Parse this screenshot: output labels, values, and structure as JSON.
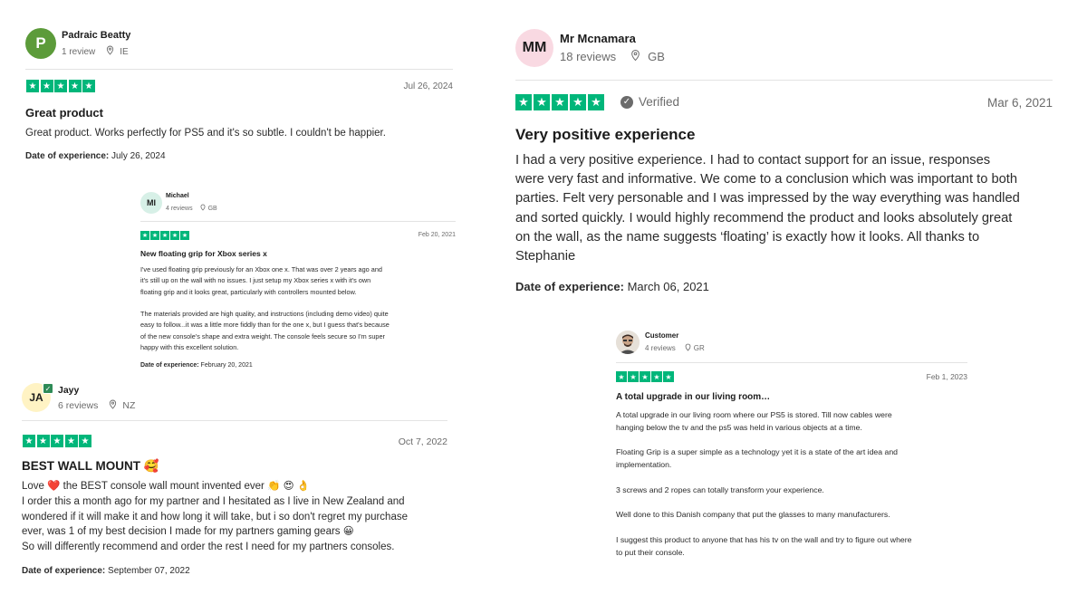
{
  "colors": {
    "star_green": "#00b67a",
    "avatar_p": "#5c9b3a",
    "avatar_mi": "#d7f0e7",
    "avatar_ja": "#fff3c4",
    "avatar_mm": "#f9d9e2"
  },
  "reviews": [
    {
      "avatar_text": "P",
      "name": "Padraic Beatty",
      "review_count": "1 review",
      "country": "IE",
      "date": "Jul 26, 2024",
      "title": "Great product",
      "body": "Great product. Works perfectly for PS5 and it's so subtle. I couldn't be happier.",
      "doe_label": "Date of experience:",
      "doe_value": "July 26, 2024"
    },
    {
      "avatar_text": "MI",
      "name": "Michael",
      "review_count": "4 reviews",
      "country": "GB",
      "date": "Feb 20, 2021",
      "title": "New floating grip for Xbox series x",
      "body": "I've used floating grip previously for an Xbox one x. That was over 2 years ago and\nit's still up on the wall with no issues. I just setup my Xbox series x with it's own\nfloating grip and it looks great, particularly with controllers mounted below.\n\nThe materials provided are high quality, and instructions (including demo video) quite\neasy to follow...it was a little more fiddly than for the one x, but I guess that's because\nof the new console's shape and extra weight. The console feels secure so I'm super\nhappy with this excellent solution.",
      "doe_label": "Date of experience:",
      "doe_value": "February 20, 2021"
    },
    {
      "avatar_text": "JA",
      "name": "Jayy",
      "review_count": "6 reviews",
      "country": "NZ",
      "date": "Oct 7, 2022",
      "title": "BEST WALL MOUNT 🥰",
      "body": "Love ❤️  the BEST console wall mount invented ever 👏 😍 👌\nI order this a month ago for my partner and I hesitated as I live in New Zealand and\nwondered if it will make it and how long it will take, but i so don't regret my purchase\never, was 1 of my best decision I made for my partners gaming gears 😀\nSo will differently recommend and order the rest I need for my partners consoles.",
      "doe_label": "Date of experience:",
      "doe_value": "September 07, 2022"
    },
    {
      "avatar_text": "MM",
      "name": "Mr Mcnamara",
      "review_count": "18 reviews",
      "country": "GB",
      "verified": "Verified",
      "date": "Mar 6, 2021",
      "title": "Very positive experience",
      "body": "I had a very positive experience. I had to contact support for an issue, responses\nwere very fast and informative. We come to a conclusion which was important to both\nparties. Felt very personable and I was impressed by the way everything was handled\nand sorted quickly. I would highly recommend the product and looks absolutely great\non the wall, as the name suggests ‘floating’ is exactly how it looks. All thanks to\nStephanie",
      "doe_label": "Date of experience:",
      "doe_value": "March 06, 2021"
    },
    {
      "avatar_text": "",
      "name": "Customer",
      "review_count": "4 reviews",
      "country": "GR",
      "date": "Feb 1, 2023",
      "title": "A total upgrade in our living room…",
      "body": "A total upgrade in our living room where our PS5 is stored. Till now cables were\nhanging below the tv and the ps5 was held in various objects at a time.\n\nFloating Grip is a super simple as a technology yet it is a state of the art idea and\nimplementation.\n\n3 screws and 2 ropes can totally transform your experience.\n\nWell done to this Danish company that put the glasses to many manufacturers.\n\nI suggest this product to anyone that has his tv on the wall and try to figure out where\nto put their console."
    }
  ]
}
